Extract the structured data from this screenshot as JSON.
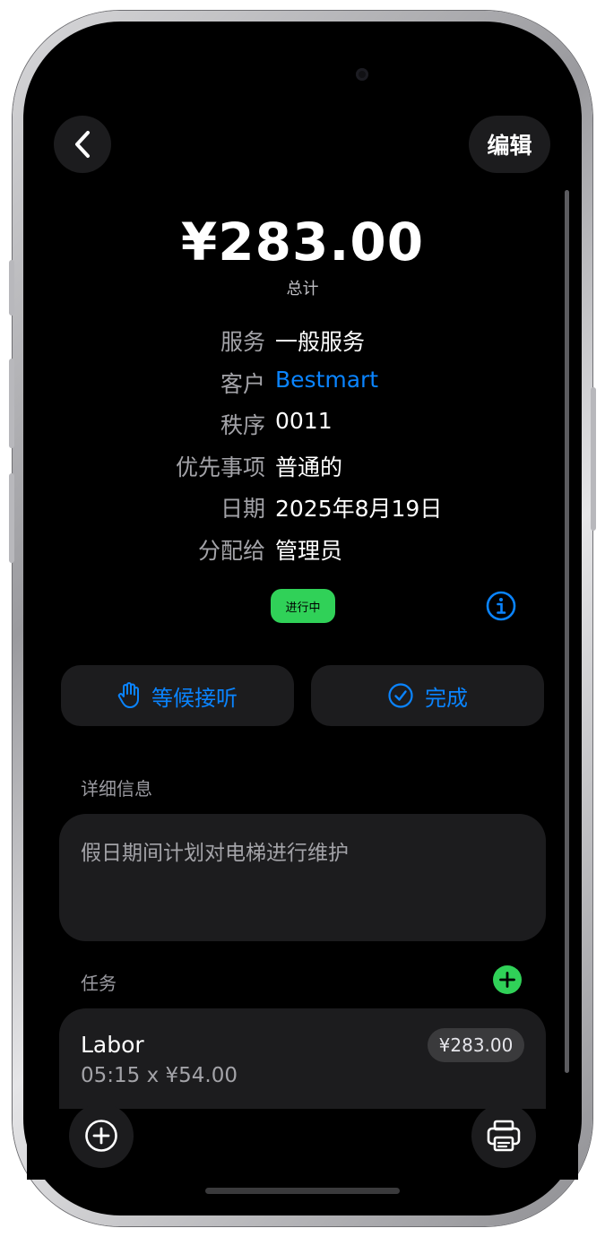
{
  "header": {
    "edit_label": "编辑"
  },
  "summary": {
    "total_amount": "¥283.00",
    "total_label": "总计"
  },
  "info": {
    "service_label": "服务",
    "service_value": "一般服务",
    "customer_label": "客户",
    "customer_value": "Bestmart",
    "sequence_label": "秩序",
    "sequence_value": "0011",
    "priority_label": "优先事项",
    "priority_value": "普通的",
    "date_label": "日期",
    "date_value": "2025年8月19日",
    "assignee_label": "分配给",
    "assignee_value": "管理员"
  },
  "status": {
    "badge": "进行中",
    "badge_color": "#30d158"
  },
  "actions": {
    "hold_label": "等候接听",
    "complete_label": "完成",
    "accent_color": "#0a84ff"
  },
  "details": {
    "section_label": "详细信息",
    "text": "假日期间计划对电梯进行维护"
  },
  "tasks": {
    "section_label": "任务",
    "items": [
      {
        "name": "Labor",
        "detail": "05:15 x ¥54.00",
        "amount": "¥283.00"
      }
    ]
  },
  "icons": {
    "back": "chevron-left-icon",
    "info": "info-circle-icon",
    "hold": "hand-raised-icon",
    "complete": "checkmark-circle-icon",
    "add_task": "plus-circle-fill-icon",
    "add": "plus-circle-icon",
    "print": "printer-icon"
  }
}
